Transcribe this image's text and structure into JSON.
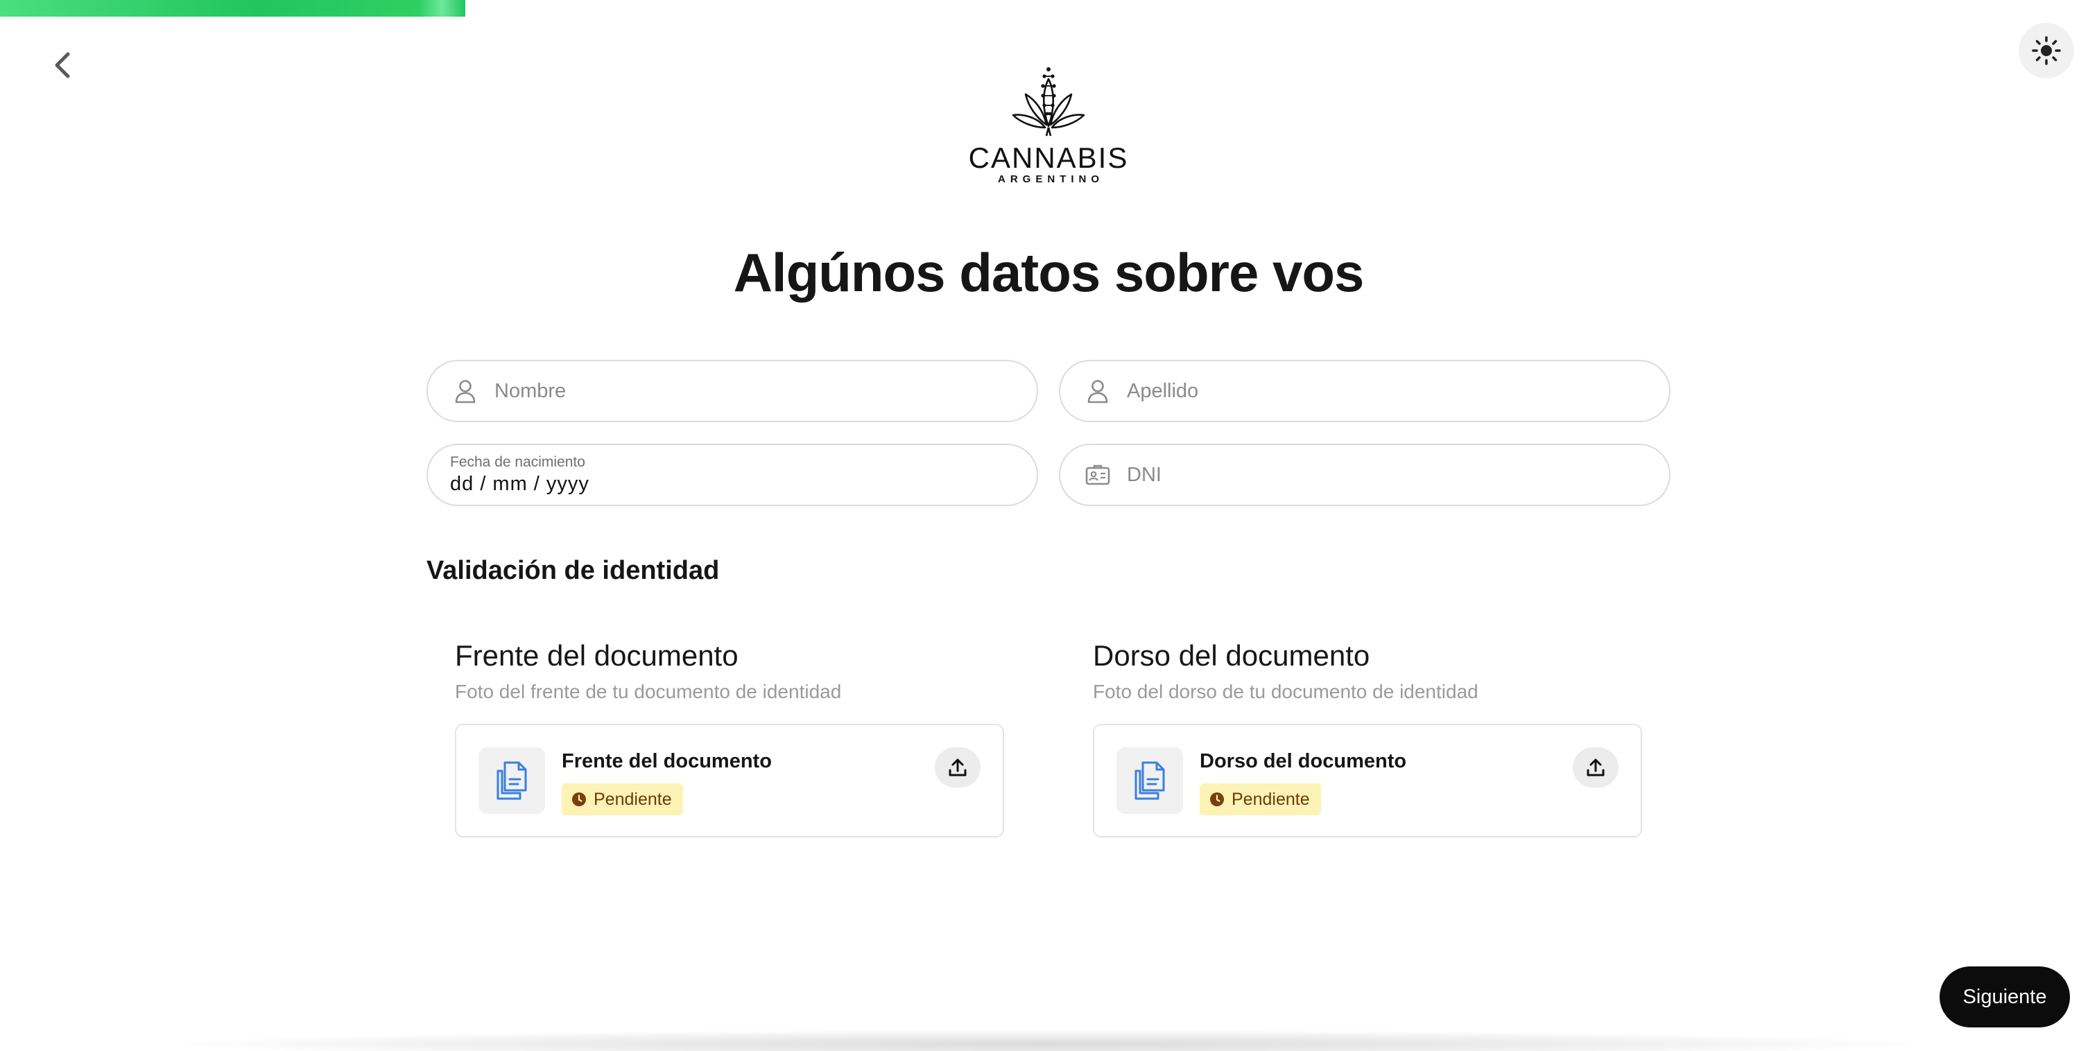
{
  "progress": {
    "fraction": 0.222,
    "color": "#22c55e"
  },
  "logo": {
    "wordmark": "CANNABIS",
    "subline": "ARGENTINO"
  },
  "heading": "Algúnos datos sobre vos",
  "form": {
    "nombre": {
      "placeholder": "Nombre",
      "icon": "person-icon"
    },
    "apellido": {
      "placeholder": "Apellido",
      "icon": "person-icon"
    },
    "fecha": {
      "label": "Fecha de nacimiento",
      "value": "dd / mm / yyyy"
    },
    "dni": {
      "placeholder": "DNI",
      "icon": "id-card-icon"
    }
  },
  "identity": {
    "title": "Validación de identidad",
    "front": {
      "title": "Frente del documento",
      "subtitle": "Foto del frente de tu documento de identidad",
      "card_name": "Frente del documento",
      "status": "Pendiente"
    },
    "back": {
      "title": "Dorso del documento",
      "subtitle": "Foto del dorso de tu documento de identidad",
      "card_name": "Dorso del documento",
      "status": "Pendiente"
    }
  },
  "buttons": {
    "next": "Siguiente"
  },
  "colors": {
    "accent": "#22c55e",
    "badge_bg": "#fdf3b5",
    "badge_text": "#6b3b0d",
    "doc_icon": "#3b7fe0"
  }
}
